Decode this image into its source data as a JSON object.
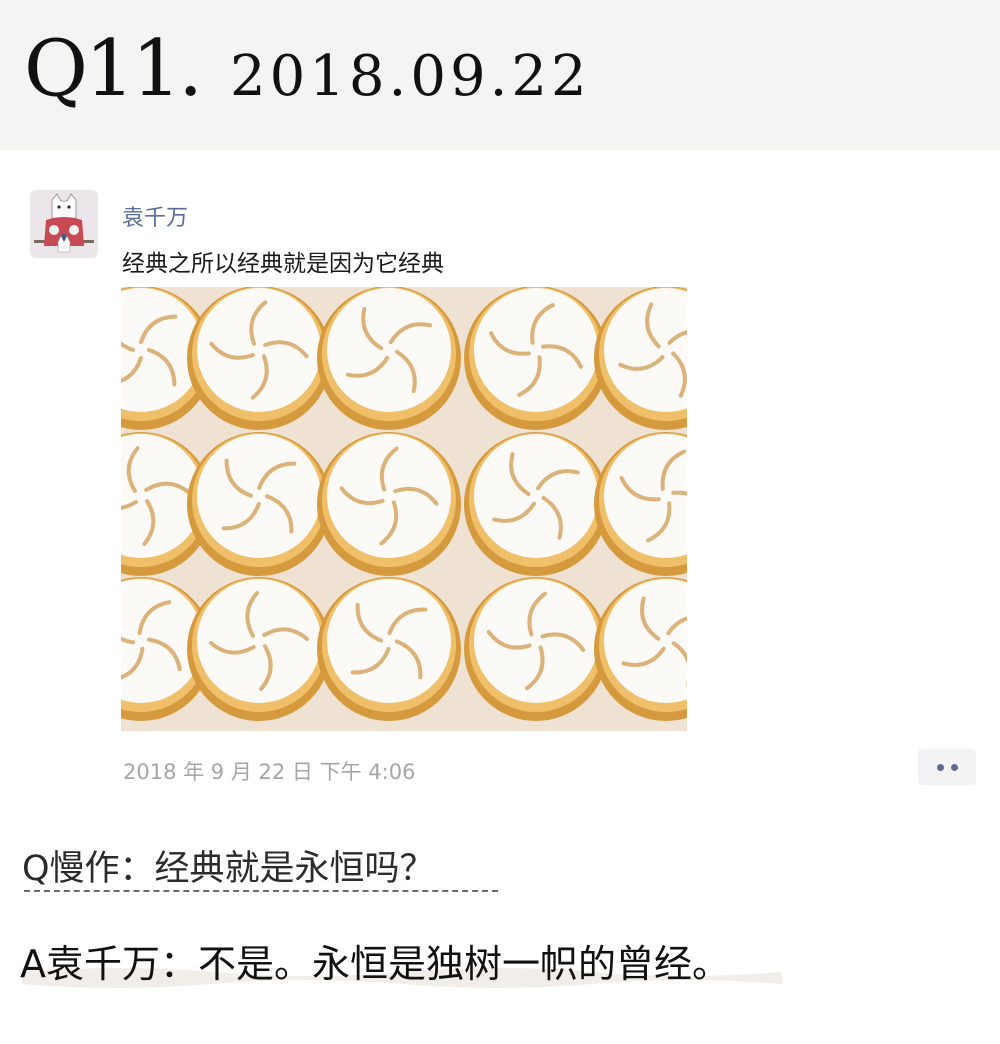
{
  "header": {
    "number": "Q11.",
    "date": "2018.09.22"
  },
  "post": {
    "author": "袁千万",
    "text": "经典之所以经典就是因为它经典",
    "time": "2018 年 9 月 22 日 下午 4:06",
    "more_icon": "ellipsis-icon",
    "link_color": "#5a6d96"
  },
  "qa": {
    "question": "Q慢作：经典就是永恒吗？",
    "answer": "A袁千万：不是。永恒是独树一帜的曾经。"
  },
  "photo_grid": {
    "rows": 3,
    "cols": 5
  }
}
